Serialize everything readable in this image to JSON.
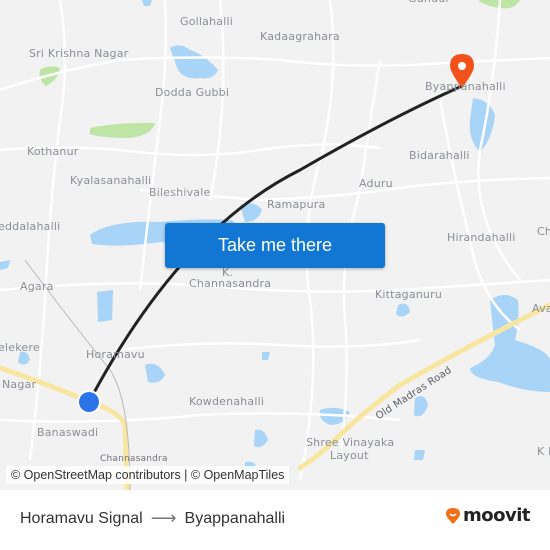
{
  "map": {
    "places": [
      {
        "id": "gollahalli",
        "label": "Gollahalli"
      },
      {
        "id": "kadaagrahara",
        "label": "Kadaagrahara"
      },
      {
        "id": "sri-krishna-nagar",
        "label": "Sri Krishna Nagar"
      },
      {
        "id": "dodda-gubbi",
        "label": "Dodda Gubbi"
      },
      {
        "id": "byappanahalli",
        "label": "Byappanahalli"
      },
      {
        "id": "kothanur",
        "label": "Kothanur"
      },
      {
        "id": "kyalasanahalli",
        "label": "Kyalasanahalli"
      },
      {
        "id": "bileshivale",
        "label": "Bileshivale"
      },
      {
        "id": "bidarahalli",
        "label": "Bidarahalli"
      },
      {
        "id": "aduru",
        "label": "Aduru"
      },
      {
        "id": "ramapura",
        "label": "Ramapura"
      },
      {
        "id": "hirandahalli",
        "label": "Hirandahalli"
      },
      {
        "id": "geddalahalli",
        "label": "eddalahalli"
      },
      {
        "id": "agara",
        "label": "Agara"
      },
      {
        "id": "k",
        "label": "K."
      },
      {
        "id": "channasandra",
        "label": "Channasandra"
      },
      {
        "id": "kittaganuru",
        "label": "Kittaganuru"
      },
      {
        "id": "avalahalli",
        "label": "Ava"
      },
      {
        "id": "chi",
        "label": "Ch"
      },
      {
        "id": "elekere",
        "label": "elekere"
      },
      {
        "id": "horamavu",
        "label": "Horamavu"
      },
      {
        "id": "nagar",
        "label": "Nagar"
      },
      {
        "id": "kowdenahalli",
        "label": "Kowdenahalli"
      },
      {
        "id": "banaswadi",
        "label": "Banaswadi"
      },
      {
        "id": "channasandra-small",
        "label": "Channasandra"
      },
      {
        "id": "shree-vinayaka",
        "label": "Shree Vinayaka"
      },
      {
        "id": "layout",
        "label": "Layout"
      },
      {
        "id": "kl",
        "label": "K L"
      },
      {
        "id": "gunduru",
        "label": "Gundur"
      }
    ],
    "roads": {
      "old_madras_road": "Old Madras Road"
    },
    "origin_color": "#2b73e8",
    "destination_color": "#f2511b",
    "route_color": "#222222",
    "water_color": "#a8d4f7",
    "park_color": "#bfe5a6",
    "major_road_color": "#f8e6a0"
  },
  "cta": {
    "label": "Take me there",
    "color": "#1176d4"
  },
  "attribution": "© OpenStreetMap contributors | © OpenMapTiles",
  "footer": {
    "origin": "Horamavu Signal",
    "arrow": "⟶",
    "destination": "Byappanahalli",
    "brand": "moovit",
    "brand_color": "#f0701c"
  }
}
